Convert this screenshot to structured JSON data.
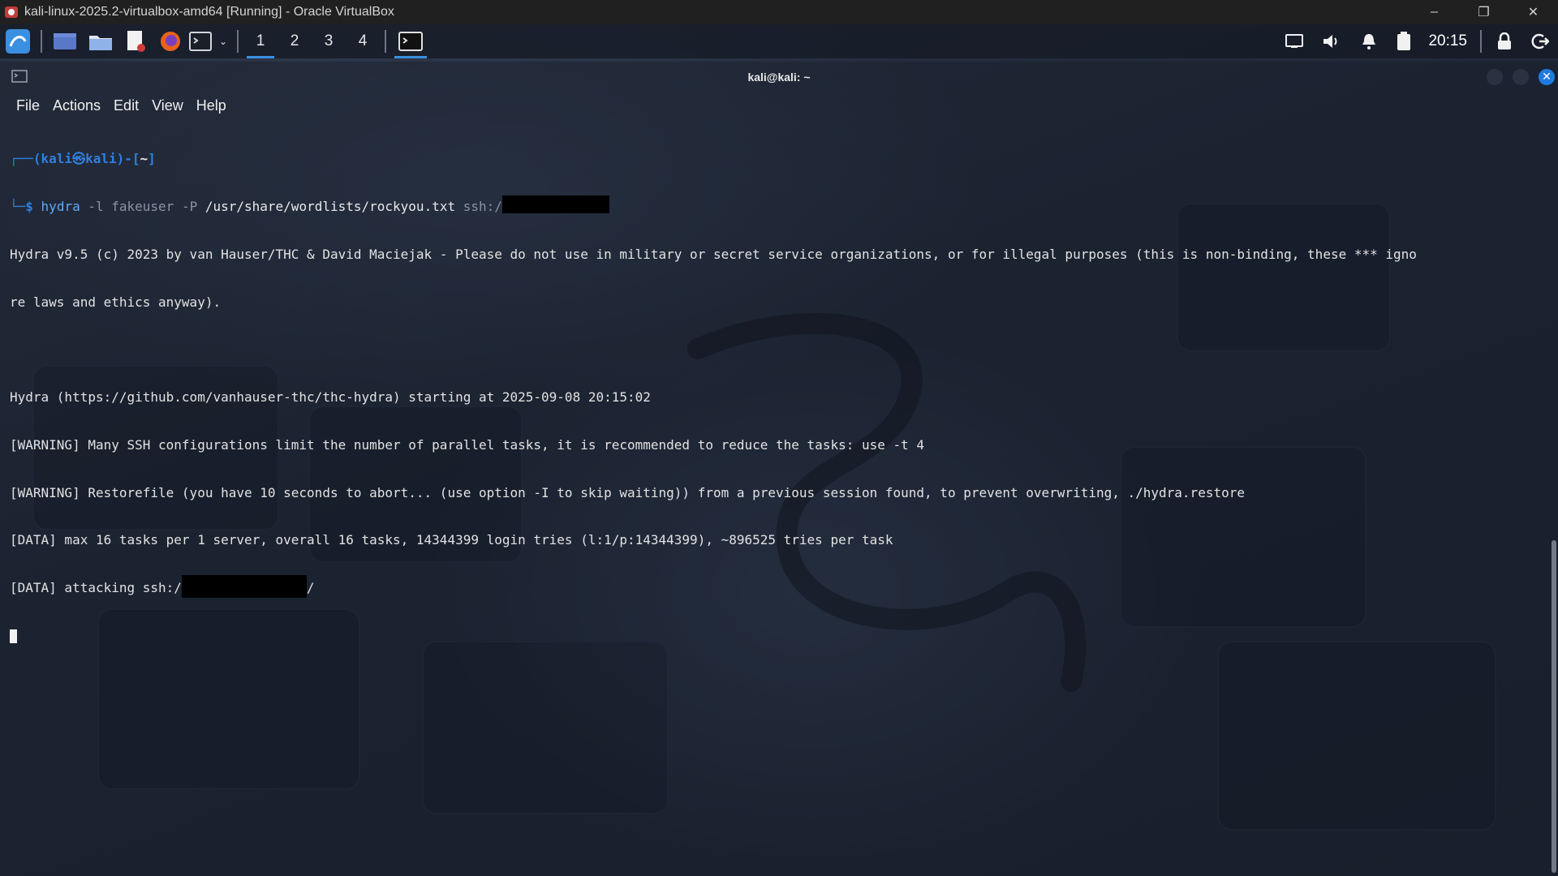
{
  "host": {
    "title": "kali-linux-2025.2-virtualbox-amd64 [Running] - Oracle VirtualBox",
    "icon": "virtualbox-icon",
    "controls": {
      "minimize": "–",
      "restore": "❐",
      "close": "✕"
    }
  },
  "panel": {
    "workspaces": [
      "1",
      "2",
      "3",
      "4"
    ],
    "active_workspace": "1",
    "clock": "20:15",
    "icons": [
      "kali-menu-icon",
      "show-desktop-icon",
      "file-manager-icon",
      "text-editor-icon",
      "firefox-icon",
      "terminal-icon",
      "chevron-down-icon",
      "terminal-task-icon",
      "display-icon",
      "volume-icon",
      "bell-icon",
      "battery-icon",
      "lock-icon",
      "logout-icon"
    ]
  },
  "terminal": {
    "title": "kali@kali: ~",
    "menu": [
      "File",
      "Actions",
      "Edit",
      "View",
      "Help"
    ],
    "prompt": {
      "top_open": "┌──(",
      "user": "kali㉿kali",
      "top_close": ")-[",
      "cwd": "~",
      "top_end": "]",
      "bottom": "└─",
      "dollar": "$"
    },
    "command": {
      "name": "hydra",
      "args_dim": " -l fakeuser -P ",
      "path": "/usr/share/wordlists/rockyou.txt",
      "target_prefix": " ssh:/"
    },
    "output": [
      "Hydra v9.5 (c) 2023 by van Hauser/THC & David Maciejak - Please do not use in military or secret service organizations, or for illegal purposes (this is non-binding, these *** igno",
      "re laws and ethics anyway).",
      "",
      "Hydra (https://github.com/vanhauser-thc/thc-hydra) starting at 2025-09-08 20:15:02",
      "[WARNING] Many SSH configurations limit the number of parallel tasks, it is recommended to reduce the tasks: use -t 4",
      "[WARNING] Restorefile (you have 10 seconds to abort... (use option -I to skip waiting)) from a previous session found, to prevent overwriting, ./hydra.restore",
      "[DATA] max 16 tasks per 1 server, overall 16 tasks, 14344399 login tries (l:1/p:14344399), ~896525 tries per task"
    ],
    "attacking_prefix": "[DATA] attacking ssh:/",
    "attacking_suffix": "/",
    "close_label": "✕"
  }
}
